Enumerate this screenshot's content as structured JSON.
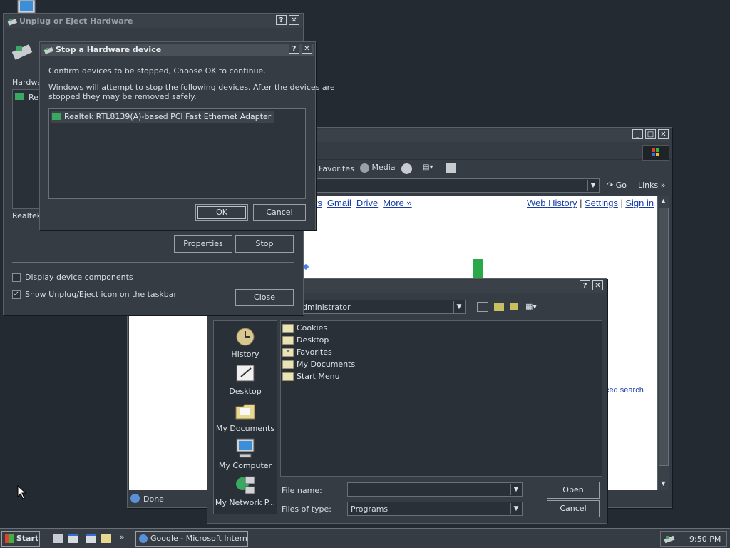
{
  "unplug_dialog": {
    "title": "Unplug or Eject Hardware",
    "help_btn": "?",
    "close_btn": "✕",
    "hardware_label": "Hardwa",
    "list_item": "Re",
    "status_text": "Realtek",
    "properties_btn": "Properties",
    "stop_btn": "Stop",
    "display_components_label": "Display device components",
    "display_components_checked": false,
    "show_icon_label": "Show Unplug/Eject icon on the taskbar",
    "show_icon_checked": true,
    "close_label": "Close"
  },
  "stop_dialog": {
    "title": "Stop a Hardware device",
    "help_btn": "?",
    "close_btn": "✕",
    "line1": "Confirm devices to be stopped, Choose OK to continue.",
    "line2": "Windows will attempt to stop the following devices. After the devices are",
    "line3": "stopped they may be removed safely.",
    "device": "Realtek RTL8139(A)-based PCI Fast Ethernet Adapter",
    "ok_btn": "OK",
    "cancel_btn": "Cancel"
  },
  "browser": {
    "min_btn": "_",
    "max_btn": "□",
    "close_btn": "✕",
    "toolbar_favorites": "Favorites",
    "toolbar_media": "Media",
    "go_label": "Go",
    "links_label": "Links",
    "nav_partial": "ws",
    "nav_gmail": "Gmail",
    "nav_drive": "Drive",
    "nav_more": "More »",
    "web_history": "Web History",
    "settings": "Settings",
    "sign_in": "Sign in",
    "advanced_search_partial": "ced search",
    "status_done": "Done"
  },
  "open_dialog": {
    "help_btn": "?",
    "close_btn": "✕",
    "look_in_value": "dministrator",
    "places": [
      "History",
      "Desktop",
      "My Documents",
      "My Computer",
      "My Network P..."
    ],
    "files": [
      {
        "name": "Cookies",
        "icon": "folder-icon"
      },
      {
        "name": "Desktop",
        "icon": "folder-icon"
      },
      {
        "name": "Favorites",
        "icon": "favorites-folder-icon"
      },
      {
        "name": "My Documents",
        "icon": "folder-icon"
      },
      {
        "name": "Start Menu",
        "icon": "folder-icon"
      }
    ],
    "file_name_label": "File name:",
    "file_name_value": "",
    "files_of_type_label": "Files of type:",
    "files_of_type_value": "Programs",
    "open_btn": "Open",
    "cancel_btn": "Cancel"
  },
  "taskbar": {
    "start_label": "Start",
    "task_label": "Google - Microsoft Intern...",
    "clock": "9:50 PM",
    "more_chevron": "»"
  }
}
